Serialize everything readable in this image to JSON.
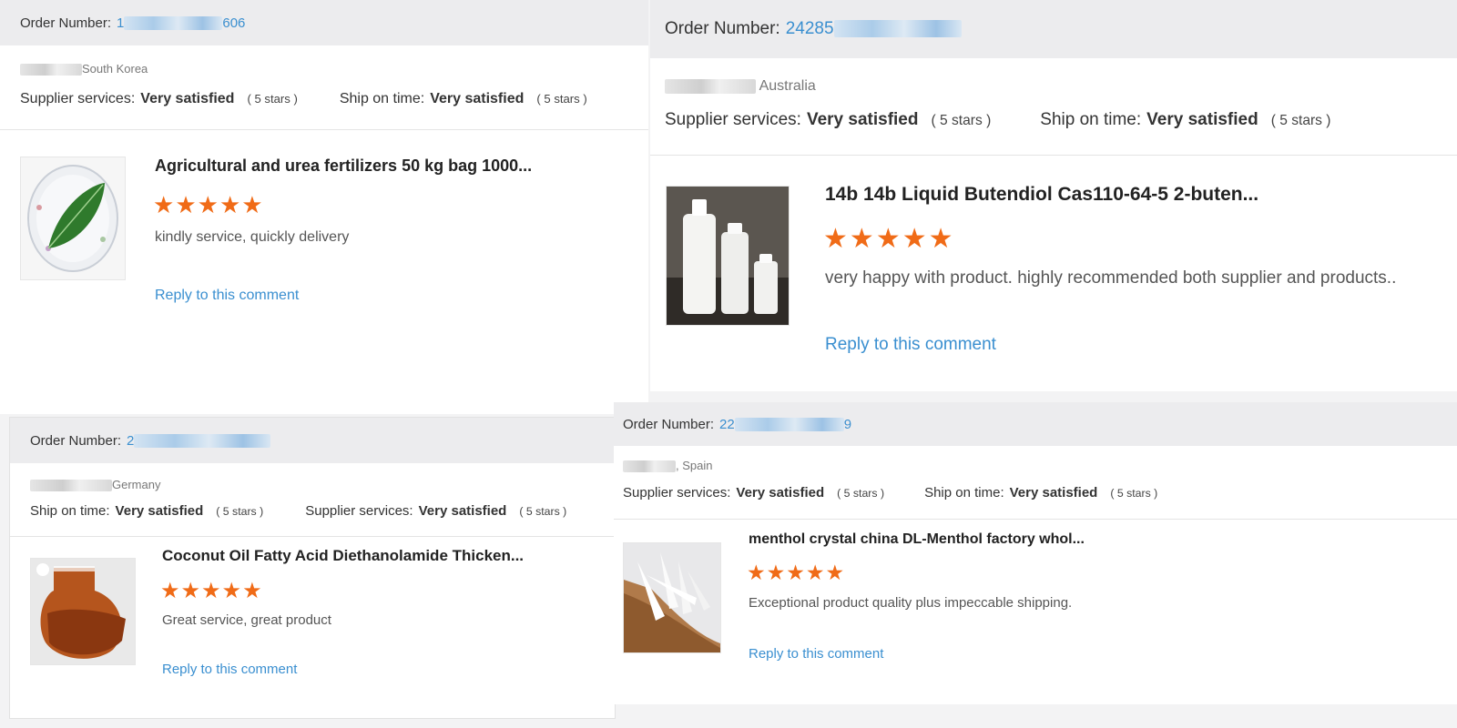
{
  "reviews": [
    {
      "order_label": "Order Number:",
      "order_prefix": "1",
      "order_suffix": "606",
      "location": "South Korea",
      "ratings": [
        {
          "label": "Supplier services:",
          "value": "Very satisfied",
          "stars": "( 5 stars )"
        },
        {
          "label": "Ship on time:",
          "value": "Very satisfied",
          "stars": "( 5 stars )"
        }
      ],
      "product_title": "Agricultural and urea fertilizers 50 kg bag 1000...",
      "rating_value": 5,
      "comment": "kindly service, quickly delivery",
      "reply_label": "Reply to this comment"
    },
    {
      "order_label": "Order Number:",
      "order_prefix": "24285",
      "order_suffix": "",
      "location": "Australia",
      "ratings": [
        {
          "label": "Supplier services:",
          "value": "Very satisfied",
          "stars": "( 5 stars )"
        },
        {
          "label": "Ship on time:",
          "value": "Very satisfied",
          "stars": "( 5 stars )"
        }
      ],
      "product_title": "14b 14b Liquid Butendiol Cas110-64-5 2-buten...",
      "rating_value": 5,
      "comment": "very happy with product. highly recommended both supplier and products..",
      "reply_label": "Reply to this comment"
    },
    {
      "order_label": "Order Number:",
      "order_prefix": "2",
      "order_suffix": "",
      "location": "Germany",
      "ratings": [
        {
          "label": "Ship on time:",
          "value": "Very satisfied",
          "stars": "( 5 stars )"
        },
        {
          "label": "Supplier services:",
          "value": "Very satisfied",
          "stars": "( 5 stars )"
        }
      ],
      "product_title": "Coconut Oil Fatty Acid Diethanolamide Thicken...",
      "rating_value": 5,
      "comment": "Great service, great product",
      "reply_label": "Reply to this comment"
    },
    {
      "order_label": "Order Number:",
      "order_prefix": "22",
      "order_suffix": "9",
      "location": ", Spain",
      "ratings": [
        {
          "label": "Supplier services:",
          "value": "Very satisfied",
          "stars": "( 5 stars )"
        },
        {
          "label": "Ship on time:",
          "value": "Very satisfied",
          "stars": "( 5 stars )"
        }
      ],
      "product_title": "menthol crystal china DL-Menthol factory whol...",
      "rating_value": 5,
      "comment": "Exceptional product quality plus impeccable shipping.",
      "reply_label": "Reply to this comment"
    }
  ],
  "colors": {
    "star": "#f06b17",
    "link": "#3a8fd0"
  },
  "icons": {
    "star": "star-icon"
  }
}
